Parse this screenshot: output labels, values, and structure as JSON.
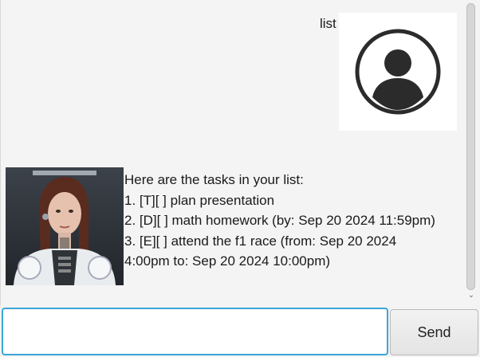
{
  "user_message": {
    "text": "list"
  },
  "bot_message": {
    "text": "Here are the tasks in your list:\n1. [T][ ] plan presentation\n2. [D][ ] math homework (by: Sep 20 2024 11:59pm)\n3. [E][ ] attend the f1 race (from: Sep 20 2024\n4:00pm to: Sep 20 2024 10:00pm)"
  },
  "input": {
    "value": "",
    "placeholder": ""
  },
  "send_button": {
    "label": "Send"
  },
  "icons": {
    "user_avatar": "user-profile-icon",
    "bot_avatar": "robot-woman-portrait",
    "scroll_arrow": "chevron-down-icon"
  },
  "colors": {
    "input_focus_border": "#3aa6d8",
    "background": "#f4f4f4"
  }
}
